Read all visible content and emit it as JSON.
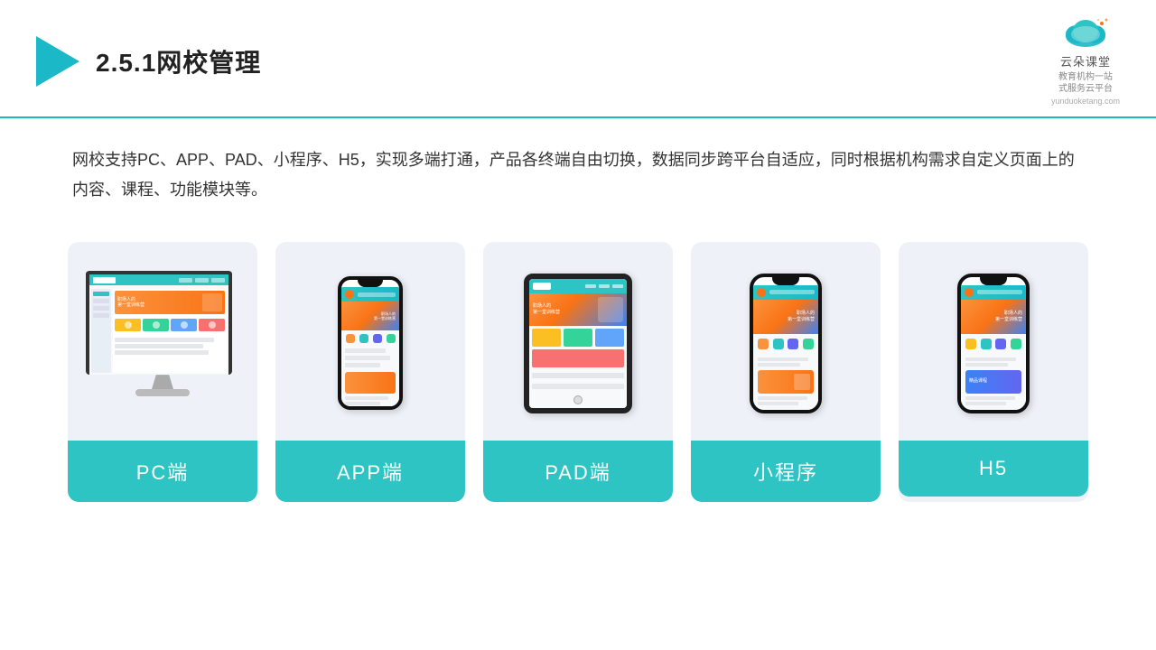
{
  "header": {
    "title": "2.5.1网校管理",
    "brand_name": "云朵课堂",
    "brand_url": "yunduoketang.com",
    "brand_slogan": "教育机构一站\n式服务云平台"
  },
  "description": {
    "text": "网校支持PC、APP、PAD、小程序、H5，实现多端打通，产品各终端自由切换，数据同步跨平台自适应，同时根据机构需求自定义页面上的内容、课程、功能模块等。"
  },
  "cards": [
    {
      "id": "pc",
      "label": "PC端"
    },
    {
      "id": "app",
      "label": "APP端"
    },
    {
      "id": "pad",
      "label": "PAD端"
    },
    {
      "id": "miniprogram",
      "label": "小程序"
    },
    {
      "id": "h5",
      "label": "H5"
    }
  ],
  "colors": {
    "accent": "#2ec4c4",
    "accent_dark": "#1bb8c8",
    "card_bg": "#eef2f8",
    "label_bg": "#2ec4c4"
  }
}
